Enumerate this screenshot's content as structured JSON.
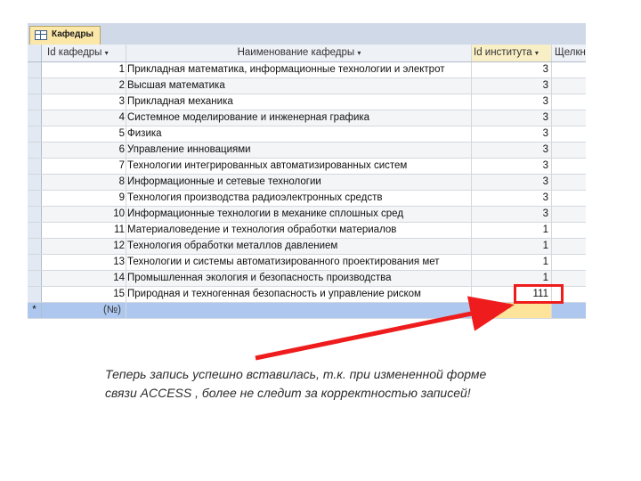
{
  "tab": {
    "label": "Кафедры",
    "icon": "table-icon"
  },
  "columns": {
    "id": "Id кафедры",
    "name": "Наименование кафедры",
    "institute": "Id института",
    "add": "Щелкн",
    "dropdown_glyph": "▾"
  },
  "rows": [
    {
      "id": "1",
      "name": "Прикладная математика, информационные технологии и электрот",
      "institute": "3"
    },
    {
      "id": "2",
      "name": "Высшая математика",
      "institute": "3"
    },
    {
      "id": "3",
      "name": "Прикладная механика",
      "institute": "3"
    },
    {
      "id": "4",
      "name": "Системное моделирование и инженерная графика",
      "institute": "3"
    },
    {
      "id": "5",
      "name": "Физика",
      "institute": "3"
    },
    {
      "id": "6",
      "name": "Управление инновациями",
      "institute": "3"
    },
    {
      "id": "7",
      "name": "Технологии интегрированных автоматизированных систем",
      "institute": "3"
    },
    {
      "id": "8",
      "name": "Информационные и сетевые технологии",
      "institute": "3"
    },
    {
      "id": "9",
      "name": "Технология производства радиоэлектронных средств",
      "institute": "3"
    },
    {
      "id": "10",
      "name": "Информационные технологии в механике сплошных сред",
      "institute": "3"
    },
    {
      "id": "11",
      "name": "Материаловедение и технология обработки материалов",
      "institute": "1"
    },
    {
      "id": "12",
      "name": "Технология обработки металлов давлением",
      "institute": "1"
    },
    {
      "id": "13",
      "name": "Технологии и системы автоматизированного проектирования мет",
      "institute": "1"
    },
    {
      "id": "14",
      "name": "Промышленная экология и безопасность производства",
      "institute": "1"
    },
    {
      "id": "15",
      "name": "Природная и техногенная безопасность и управление риском",
      "institute": "111"
    }
  ],
  "new_row": {
    "selector": "*",
    "id_placeholder": "(№)"
  },
  "caption": "Теперь запись успешно вставилась, т.к. при измененной форме связи ACCESS , более не следит за корректностью записей!",
  "colors": {
    "highlight": "#ee1c1c",
    "new_row": "#aec7ee",
    "tab": "#fbe7a8"
  }
}
